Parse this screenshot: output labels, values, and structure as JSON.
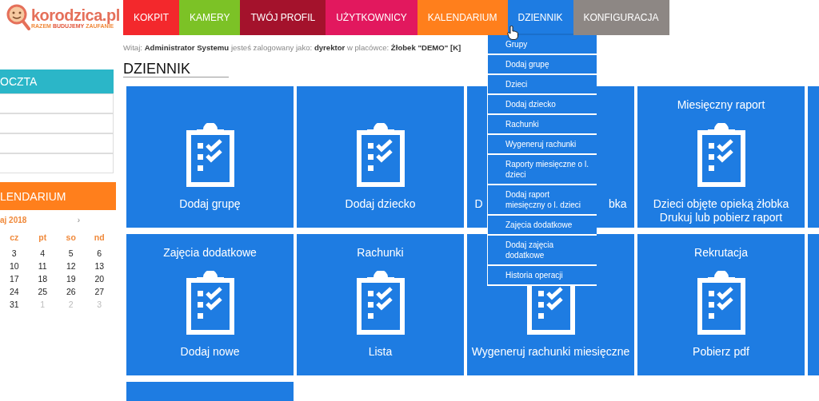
{
  "logo": {
    "name": "korodzica.pl",
    "tagline": [
      {
        "word": "RAZEM",
        "color": "#f08a3c"
      },
      {
        "word": "BUDUJEMY",
        "color": "#e2553a"
      },
      {
        "word": "ZAUFANIE",
        "color": "#f08a3c"
      }
    ]
  },
  "nav": [
    {
      "label": "KOKPIT",
      "color": "#f3282c",
      "selected": false
    },
    {
      "label": "KAMERY",
      "color": "#7cc226",
      "selected": false
    },
    {
      "label": "TWÓJ PROFIL",
      "color": "#a4122c",
      "selected": false
    },
    {
      "label": "UŻYTKOWNICY",
      "color": "#e2185e",
      "selected": false
    },
    {
      "label": "KALENDARIUM",
      "color": "#ff7f1c",
      "selected": false
    },
    {
      "label": "DZIENNIK",
      "color": "#1e7ce2",
      "selected": true
    },
    {
      "label": "KONFIGURACJA",
      "color": "#8d8784",
      "selected": false
    }
  ],
  "welcome": "Witaj: **Administrator Systemu** jesteś zalogowany jako: **dyrektor** w placówce: **Żłobek \"DEMO\" [K]**",
  "heading": "DZIENNIK",
  "sidebar": {
    "mail": {
      "title": "OCZTA"
    },
    "calendar": {
      "title": "LENDARIUM",
      "month": "aj 2018",
      "next": "›",
      "weekdays": [
        "cz",
        "pt",
        "so",
        "nd"
      ],
      "weeks": [
        [
          {
            "day": "3",
            "other": false
          },
          {
            "day": "4",
            "other": false
          },
          {
            "day": "5",
            "other": false
          },
          {
            "day": "6",
            "other": false
          }
        ],
        [
          {
            "day": "10",
            "other": false
          },
          {
            "day": "11",
            "other": false
          },
          {
            "day": "12",
            "other": false
          },
          {
            "day": "13",
            "other": false
          }
        ],
        [
          {
            "day": "17",
            "other": false
          },
          {
            "day": "18",
            "other": false
          },
          {
            "day": "19",
            "other": false
          },
          {
            "day": "20",
            "other": false
          }
        ],
        [
          {
            "day": "24",
            "other": false
          },
          {
            "day": "25",
            "other": false
          },
          {
            "day": "26",
            "other": false
          },
          {
            "day": "27",
            "other": false
          }
        ],
        [
          {
            "day": "31",
            "other": false
          },
          {
            "day": "1",
            "other": true
          },
          {
            "day": "2",
            "other": true
          },
          {
            "day": "3",
            "other": true
          }
        ]
      ]
    }
  },
  "tiles": [
    {
      "label": "Dodaj grupę"
    },
    {
      "label": "Dodaj dziecko"
    },
    {
      "kind": "covered",
      "label_left": "D",
      "label_right": "bka"
    },
    {
      "title": "Miesięczny raport",
      "label": "Dzieci objęte opieką żłobka",
      "label_2": "Drukuj lub pobierz raport"
    },
    {
      "kind": "edge"
    },
    {
      "title": "Zajęcia dodatkowe",
      "label": "Dodaj nowe"
    },
    {
      "title": "Rachunki",
      "label": "Lista"
    },
    {
      "label": "Wygeneruj rachunki miesięczne"
    },
    {
      "title": "Rekrutacja",
      "label": "Pobierz pdf"
    },
    {
      "kind": "edge"
    },
    {
      "kind": "empty"
    }
  ],
  "dropdown": [
    "Grupy",
    "Dodaj grupę",
    "Dzieci",
    "Dodaj dziecko",
    "Rachunki",
    "Wygeneruj rachunki",
    "Raporty miesięczne o l. dzieci",
    "Dodaj raport miesięczny o l. dzieci",
    "Zajęcia dodatkowe",
    "Dodaj zajęcia dodatkowe",
    "Historia operacji"
  ]
}
